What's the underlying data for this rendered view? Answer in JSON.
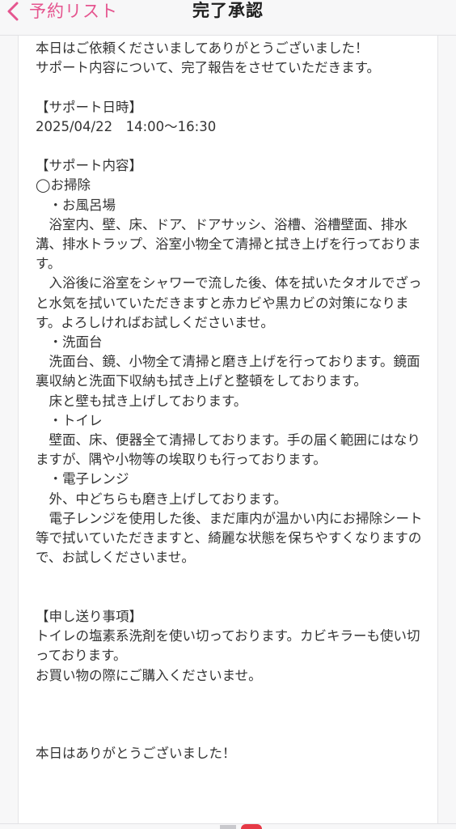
{
  "header": {
    "back_label": "予約リスト",
    "title": "完了承認",
    "accent_color": "#e5558f"
  },
  "report": {
    "greeting": "本日はご依頼くださいましてありがとうございました！\nサポート内容について、完了報告をさせていただきます。",
    "datetime_heading": "【サポート日時】",
    "datetime_value": "2025/04/22　14:00〜16:30",
    "content_heading": "【サポート内容】",
    "cleaning_heading": "◯お掃除",
    "bath_heading": "　・お風呂場",
    "bath_text": "　浴室内、壁、床、ドア、ドアサッシ、浴槽、浴槽壁面、排水溝、排水トラップ、浴室小物全て清掃と拭き上げを行っております。",
    "bath_tip": "　入浴後に浴室をシャワーで流した後、体を拭いたタオルでざっと水気を拭いていただきますと赤カビや黒カビの対策になります。よろしければお試しくださいませ。",
    "sink_heading": "　・洗面台",
    "sink_text": "　洗面台、鏡、小物全て清掃と磨き上げを行っております。鏡面裏収納と洗面下収納も拭き上げと整頓をしております。",
    "sink_text2": "　床と壁も拭き上げしております。",
    "toilet_heading": "　・トイレ",
    "toilet_text": "　壁面、床、便器全て清掃しております。手の届く範囲にはなりますが、隅や小物等の埃取りも行っております。",
    "microwave_heading": "　・電子レンジ",
    "microwave_text": "　外、中どちらも磨き上げしております。",
    "microwave_tip": "　電子レンジを使用した後、まだ庫内が温かい内にお掃除シート等で拭いていただきますと、綺麗な状態を保ちやすくなりますので、お試しくださいませ。",
    "notes_heading": "【申し送り事項】",
    "notes_text": "トイレの塩素系洗剤を使い切っております。カビキラーも使い切っております。\nお買い物の際にご購入くださいませ。",
    "closing": "本日はありがとうございました！"
  },
  "icons": {
    "back": "chevron-left-icon",
    "bottom": "tab-icon",
    "badge": "notification-badge"
  }
}
